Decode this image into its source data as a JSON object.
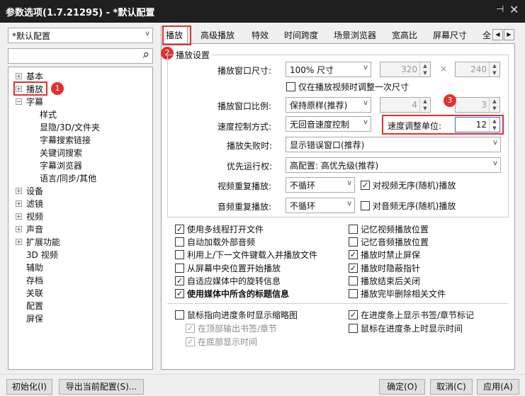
{
  "window": {
    "title": "参数选项(1.7.21295) - *默认配置",
    "pin_glyph": "⊣",
    "close_glyph": "✕"
  },
  "profile": {
    "selected": "*默认配置",
    "search_placeholder": ""
  },
  "tree": {
    "items": [
      {
        "label": "基本",
        "expandable": true
      },
      {
        "label": "播放",
        "expandable": true
      },
      {
        "label": "字幕",
        "expandable": true,
        "expanded": true
      },
      {
        "label": "样式"
      },
      {
        "label": "显隐/3D/文件夹"
      },
      {
        "label": "字幕搜索链接"
      },
      {
        "label": "关键词搜索"
      },
      {
        "label": "字幕浏览器"
      },
      {
        "label": "语言/同步/其他"
      },
      {
        "label": "设备",
        "expandable": true
      },
      {
        "label": "滤镜",
        "expandable": true
      },
      {
        "label": "视频",
        "expandable": true
      },
      {
        "label": "声音",
        "expandable": true
      },
      {
        "label": "扩展功能",
        "expandable": true
      },
      {
        "label": "3D 视频"
      },
      {
        "label": "辅助"
      },
      {
        "label": "存档"
      },
      {
        "label": "关联"
      },
      {
        "label": "配置"
      },
      {
        "label": "屏保"
      }
    ]
  },
  "tabs": [
    {
      "label": "播放",
      "active": true
    },
    {
      "label": "高级播放"
    },
    {
      "label": "特效"
    },
    {
      "label": "时间跨度"
    },
    {
      "label": "场景浏览器"
    },
    {
      "label": "宽高比"
    },
    {
      "label": "屏幕尺寸"
    },
    {
      "label": "全"
    }
  ],
  "tab_nav": {
    "left": "◀",
    "right": "▶"
  },
  "playback": {
    "group_title": "播放设置",
    "window_size": {
      "label": "播放窗口尺寸:",
      "value": "100% 尺寸",
      "width": "320",
      "times": "×",
      "height": "240",
      "adjust_once": "仅在播放视频时调整一次尺寸"
    },
    "window_ratio": {
      "label": "播放窗口比例:",
      "value": "保持原样(推荐)",
      "w": "4",
      "h": "3"
    },
    "speed_control": {
      "label": "速度控制方式:",
      "value": "无回音速度控制",
      "unit_label": "速度调整单位:",
      "unit_value": "12"
    },
    "on_fail": {
      "label": "播放失败时:",
      "value": "显示错误窗口(推荐)"
    },
    "priority": {
      "label": "优先运行权:",
      "value": "高配置: 高优先级(推荐)"
    },
    "video_repeat": {
      "label": "视频重复播放:",
      "value": "不循环",
      "random": "对视频无序(随机)播放",
      "random_checked": true
    },
    "audio_repeat": {
      "label": "音频重复播放:",
      "value": "不循环",
      "random": "对音频无序(随机)播放",
      "random_checked": false
    }
  },
  "options_left": [
    {
      "label": "使用多线程打开文件",
      "checked": true
    },
    {
      "label": "自动加载外部音频",
      "checked": false
    },
    {
      "label": "利用上/下一文件键载入并播放文件",
      "checked": false
    },
    {
      "label": "从屏幕中央位置开始播放",
      "checked": false
    },
    {
      "label": "自适应媒体中的旋转信息",
      "checked": true
    },
    {
      "label": "使用媒体中所含的标题信息",
      "checked": true,
      "bold": true
    }
  ],
  "options_right": [
    {
      "label": "记忆视频播放位置",
      "checked": false
    },
    {
      "label": "记忆音频播放位置",
      "checked": false
    },
    {
      "label": "播放时禁止屏保",
      "checked": true
    },
    {
      "label": "播放时隐蔽指针",
      "checked": true
    },
    {
      "label": "播放结束后关闭",
      "checked": false
    },
    {
      "label": "播放完毕删除相关文件",
      "checked": false
    }
  ],
  "thumbs": {
    "show_thumb": {
      "label": "鼠标指向进度条时显示缩略图",
      "checked": false
    },
    "top_bookmark": {
      "label": "在顶部输出书签/章节",
      "checked": true
    },
    "bottom_time": {
      "label": "在底部显示时间",
      "checked": true
    },
    "show_bookmarks": {
      "label": "在进度条上显示书签/章节标记",
      "checked": true
    },
    "hover_time": {
      "label": "鼠标在进度条上时显示时间",
      "checked": false
    }
  },
  "footer": {
    "init": "初始化(I)",
    "export": "导出当前配置(S)...",
    "ok": "确定(O)",
    "cancel": "取消(C)",
    "apply": "应用(A)"
  },
  "glyphs": {
    "check": "✓",
    "dropdown": "v",
    "spin_up": "▲",
    "spin_down": "▼",
    "plus": "+",
    "minus": "−",
    "search": "⌕"
  },
  "badges": [
    "1",
    "2",
    "3"
  ],
  "colors": {
    "accent_red": "#e03131",
    "titlebar": "#1f1f1f"
  }
}
